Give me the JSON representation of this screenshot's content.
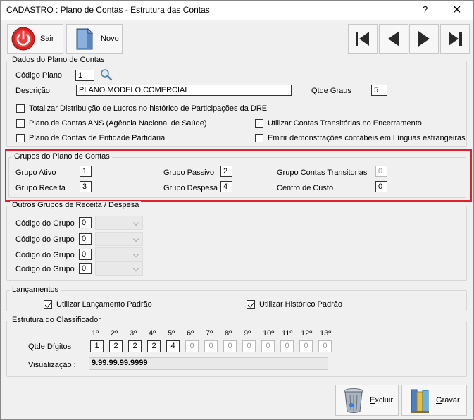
{
  "window": {
    "title": "CADASTRO : Plano de Contas - Estrutura das Contas",
    "help": "?",
    "close": "✕"
  },
  "toolbar": {
    "sair_pre": "S",
    "sair_post": "air",
    "novo_pre": "N",
    "novo_post": "ovo"
  },
  "dados": {
    "legend": "Dados do Plano de Contas",
    "codigo_label": "Código Plano",
    "codigo_value": "1",
    "descricao_label": "Descrição",
    "descricao_value": "PLANO MODELO COMERCIAL",
    "qtde_graus_label": "Qtde Graus",
    "qtde_graus_value": "5",
    "checks": [
      {
        "label": "Totalizar Distribuição de Lucros no histórico de Participações da DRE",
        "checked": false
      },
      {
        "label": "Plano de Contas ANS (Agência Nacional de Saúde)",
        "checked": false
      },
      {
        "label": "Utilizar Contas Transitórias no Encerramento",
        "checked": false
      },
      {
        "label": "Plano de Contas de Entidade Partidária",
        "checked": false
      },
      {
        "label": "Emitir demonstrações contábeis em Línguas estrangeiras",
        "checked": false
      }
    ]
  },
  "grupos": {
    "legend": "Grupos do Plano de Contas",
    "ativo_label": "Grupo Ativo",
    "ativo_value": "1",
    "passivo_label": "Grupo Passivo",
    "passivo_value": "2",
    "transitorias_label": "Grupo Contas Transitorias",
    "transitorias_value": "0",
    "receita_label": "Grupo Receita",
    "receita_value": "3",
    "despesa_label": "Grupo Despesa",
    "despesa_value": "4",
    "custo_label": "Centro de Custo",
    "custo_value": "0"
  },
  "outros": {
    "legend": "Outros Grupos de Receita / Despesa",
    "rows": [
      {
        "label": "Código do Grupo",
        "value": "0"
      },
      {
        "label": "Código do Grupo",
        "value": "0"
      },
      {
        "label": "Código do Grupo",
        "value": "0"
      },
      {
        "label": "Código do Grupo",
        "value": "0"
      }
    ]
  },
  "lancamentos": {
    "legend": "Lançamentos",
    "padrao_label": "Utilizar Lançamento Padrão",
    "padrao_checked": true,
    "historico_label": "Utilizar Histórico Padrão",
    "historico_checked": true
  },
  "estrutura": {
    "legend": "Estrutura do Classificador",
    "ordinals": [
      "1º",
      "2º",
      "3º",
      "4º",
      "5º",
      "6º",
      "7º",
      "8º",
      "9º",
      "10º",
      "11º",
      "12º",
      "13º"
    ],
    "digits_label": "Qtde Dígitos",
    "digits": [
      "1",
      "2",
      "2",
      "2",
      "4",
      "0",
      "0",
      "0",
      "0",
      "0",
      "0",
      "0",
      "0"
    ],
    "viz_label": "Visualização :",
    "viz_value": "9.99.99.99.9999"
  },
  "footer": {
    "excluir_pre": "E",
    "excluir_post": "xcluir",
    "gravar_pre": "G",
    "gravar_post": "ravar"
  },
  "colors": {
    "highlight": "#e0202a",
    "background": "#f0f0f0"
  }
}
